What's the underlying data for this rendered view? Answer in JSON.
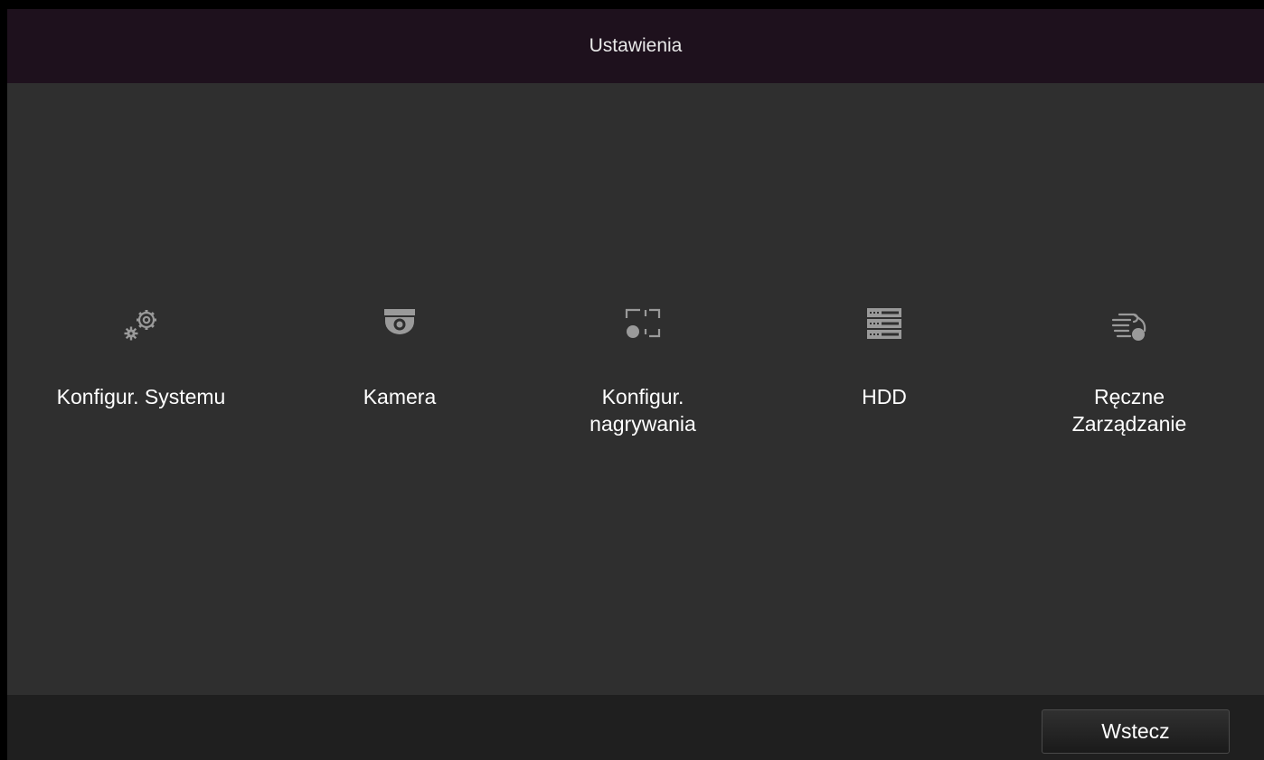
{
  "header": {
    "title": "Ustawienia"
  },
  "menu": {
    "items": [
      {
        "icon": "gears-icon",
        "label_lines": [
          "Konfigur. Systemu"
        ]
      },
      {
        "icon": "dome-camera-icon",
        "label_lines": [
          "Kamera"
        ]
      },
      {
        "icon": "record-config-icon",
        "label_lines": [
          "Konfigur.",
          "nagrywania"
        ]
      },
      {
        "icon": "hdd-rack-icon",
        "label_lines": [
          "HDD"
        ]
      },
      {
        "icon": "manual-operation-icon",
        "label_lines": [
          "Ręczne",
          "Zarządzanie"
        ]
      }
    ]
  },
  "footer": {
    "back_label": "Wstecz"
  },
  "colors": {
    "background": "#2f2f2f",
    "title_bar": "#1e111d",
    "footer_bar": "#1f1f1f",
    "icon": "#9a9a9a",
    "text": "#ffffff"
  }
}
